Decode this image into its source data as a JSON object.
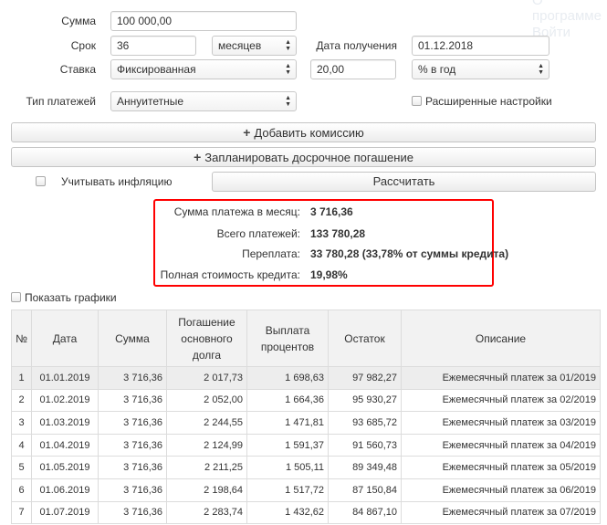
{
  "background_menu": {
    "item1": "О программе",
    "item2": "Войти"
  },
  "form": {
    "sum_label": "Сумма",
    "sum_value": "100 000,00",
    "term_label": "Срок",
    "term_value": "36",
    "term_unit": "месяцев",
    "date_label": "Дата получения",
    "date_value": "01.12.2018",
    "rate_label": "Ставка",
    "rate_type": "Фиксированная",
    "rate_value": "20,00",
    "rate_unit": "% в год",
    "payment_type_label": "Тип платежей",
    "payment_type": "Аннуитетные",
    "advanced_label": "Расширенные настройки",
    "add_commission": "Добавить комиссию",
    "plan_early": "Запланировать досрочное погашение",
    "inflation_label": "Учитывать инфляцию",
    "calculate": "Рассчитать"
  },
  "summary": {
    "monthly_label": "Сумма платежа в месяц:",
    "monthly_value": "3 716,36",
    "total_label": "Всего платежей:",
    "total_value": "133 780,28",
    "overpay_label": "Переплата:",
    "overpay_value": "33 780,28 (33,78% от суммы кредита)",
    "full_cost_label": "Полная стоимость кредита:",
    "full_cost_value": "19,98%"
  },
  "show_charts_label": "Показать графики",
  "table": {
    "headers": [
      "№",
      "Дата",
      "Сумма",
      "Погашение основного долга",
      "Выплата процентов",
      "Остаток",
      "Описание"
    ],
    "rows": [
      [
        "1",
        "01.01.2019",
        "3 716,36",
        "2 017,73",
        "1 698,63",
        "97 982,27",
        "Ежемесячный платеж за 01/2019"
      ],
      [
        "2",
        "01.02.2019",
        "3 716,36",
        "2 052,00",
        "1 664,36",
        "95 930,27",
        "Ежемесячный платеж за 02/2019"
      ],
      [
        "3",
        "01.03.2019",
        "3 716,36",
        "2 244,55",
        "1 471,81",
        "93 685,72",
        "Ежемесячный платеж за 03/2019"
      ],
      [
        "4",
        "01.04.2019",
        "3 716,36",
        "2 124,99",
        "1 591,37",
        "91 560,73",
        "Ежемесячный платеж за 04/2019"
      ],
      [
        "5",
        "01.05.2019",
        "3 716,36",
        "2 211,25",
        "1 505,11",
        "89 349,48",
        "Ежемесячный платеж за 05/2019"
      ],
      [
        "6",
        "01.06.2019",
        "3 716,36",
        "2 198,64",
        "1 517,72",
        "87 150,84",
        "Ежемесячный платеж за 06/2019"
      ],
      [
        "7",
        "01.07.2019",
        "3 716,36",
        "2 283,74",
        "1 432,62",
        "84 867,10",
        "Ежемесячный платеж за 07/2019"
      ]
    ]
  }
}
